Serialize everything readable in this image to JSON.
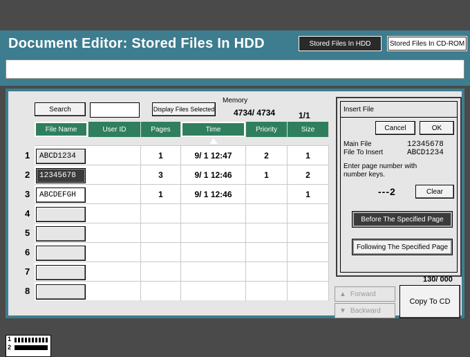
{
  "header": {
    "title": "Document Editor: Stored Files In HDD",
    "tab_hdd": "Stored Files In HDD",
    "tab_cdrom": "Stored Files In CD-ROM"
  },
  "toolbar": {
    "search_label": "Search",
    "search_value": "",
    "display_selected_label": "Display Files Selected",
    "memory_label": "Memory",
    "memory_value": "4734/  4734",
    "page_indicator": "1/1"
  },
  "table": {
    "headers": [
      "File Name",
      "User ID",
      "Pages",
      "Time",
      "Priority",
      "Size"
    ],
    "rows": [
      {
        "num": "1",
        "file": "ABCD1234",
        "user": "",
        "pages": "1",
        "time": "9/ 1 12:47",
        "priority": "2",
        "size": "1"
      },
      {
        "num": "2",
        "file": "12345678",
        "user": "",
        "pages": "3",
        "time": "9/ 1 12:46",
        "priority": "1",
        "size": "2"
      },
      {
        "num": "3",
        "file": "ABCDEFGH",
        "user": "",
        "pages": "1",
        "time": "9/ 1 12:46",
        "priority": "",
        "size": "1"
      },
      {
        "num": "4",
        "file": "",
        "user": "",
        "pages": "",
        "time": "",
        "priority": "",
        "size": ""
      },
      {
        "num": "5",
        "file": "",
        "user": "",
        "pages": "",
        "time": "",
        "priority": "",
        "size": ""
      },
      {
        "num": "6",
        "file": "",
        "user": "",
        "pages": "",
        "time": "",
        "priority": "",
        "size": ""
      },
      {
        "num": "7",
        "file": "",
        "user": "",
        "pages": "",
        "time": "",
        "priority": "",
        "size": ""
      },
      {
        "num": "8",
        "file": "",
        "user": "",
        "pages": "",
        "time": "",
        "priority": "",
        "size": ""
      }
    ]
  },
  "insert": {
    "title": "Insert File",
    "cancel": "Cancel",
    "ok": "OK",
    "main_file_label": "Main File",
    "main_file_value": "12345678",
    "file_to_insert_label": "File To Insert",
    "file_to_insert_value": "ABCD1234",
    "instruction": "Enter page number with number keys.",
    "page_entry": "---2",
    "clear": "Clear",
    "before": "Before The Specified Page",
    "following": "Following The Specified Page"
  },
  "side_counter": "130/   000",
  "nav": {
    "forward": "Forward",
    "backward": "Backward",
    "copy_to_cd": "Copy To CD"
  },
  "status": {
    "job1": "1",
    "job2": "2"
  }
}
